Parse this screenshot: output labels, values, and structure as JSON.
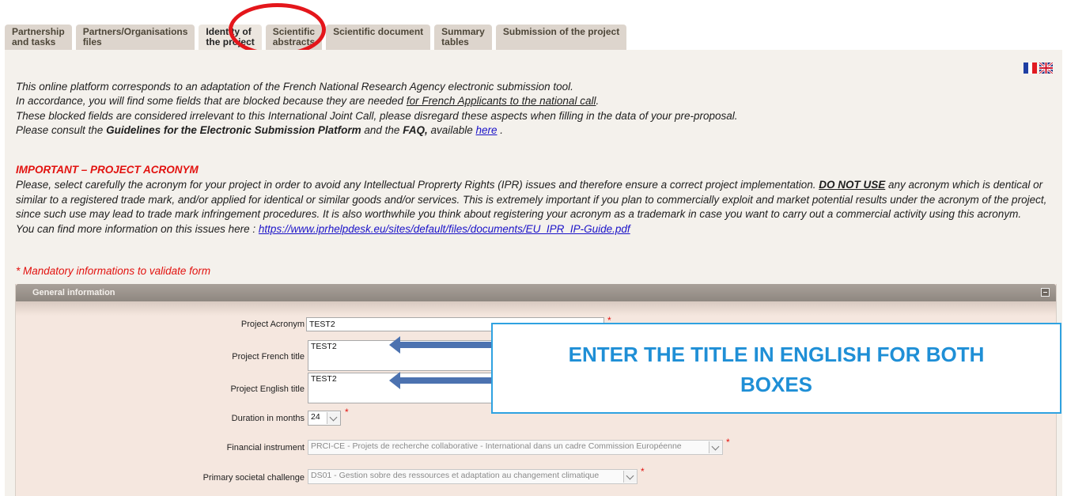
{
  "tabs": [
    {
      "label": "Partnership\nand tasks"
    },
    {
      "label": "Partners/Organisations\nfiles"
    },
    {
      "label": "Identity of\nthe project"
    },
    {
      "label": "Scientific\nabstracts"
    },
    {
      "label": "Scientific document"
    },
    {
      "label": "Summary\ntables"
    },
    {
      "label": "Submission of the project"
    }
  ],
  "active_tab": "Identity of the project",
  "languages": [
    {
      "icon": "french-flag-icon"
    },
    {
      "icon": "uk-flag-icon"
    }
  ],
  "intro": {
    "line1": "This online platform corresponds to an adaptation of the French National Research Agency electronic submission tool.",
    "line2_a": "In accordance, you will find some fields that are blocked  because they are needed ",
    "line2_u": "for French Applicants to the national call",
    "line2_b": ".",
    "line3": "These blocked fields are considered irrelevant to this International Joint Call, please disregard these aspects when filling in the data of your pre-proposal.",
    "line4_a": "Please consult the ",
    "line4_b1": "Guidelines for the Electronic Submission Platform",
    "line4_c": " and the ",
    "line4_b2": "FAQ,",
    "line4_d": " available ",
    "line4_link": "here",
    "line4_e": " ."
  },
  "important": {
    "title": "IMPORTANT – PROJECT ACRONYM",
    "p_a": "Please, select carefully the acronym for your project in order to avoid any Intellectual Proprerty Rights (IPR) issues and therefore ensure a correct project implementation. ",
    "p_bold": "DO NOT USE",
    "p_b": " any acronym which is dentical or similar to a registered trade mark, and/or applied for identical or similar goods and/or services. This is extremely important if you plan to commercially exploit and market potential results under the acronym of the project, since such use may lead to trade mark infringement procedures. It is also worthwhile you think about registering your acronym as a trademark in case you want to carry out a commercial activity using this acronym.",
    "more_prefix": "You can find more information on this issues here : ",
    "more_link": "https://www.iprhelpdesk.eu/sites/default/files/documents/EU_IPR_IP-Guide.pdf"
  },
  "mandatory_note": "* Mandatory informations to validate form",
  "section": {
    "title": "General information",
    "collapse_icon": "minus-box-icon"
  },
  "form": {
    "acronym_label": "Project Acronym",
    "acronym_value": "TEST2",
    "french_title_label": "Project French title",
    "french_title_value": "TEST2",
    "english_title_label": "Project English title",
    "english_title_value": "TEST2",
    "duration_label": "Duration in months",
    "duration_value": "24",
    "financial_label": "Financial instrument",
    "financial_value": "PRCI-CE - Projets de recherche collaborative - International dans un cadre Commission Européenne",
    "challenge_label": "Primary societal challenge",
    "challenge_value": "DS01 - Gestion sobre des ressources et adaptation au changement climatique",
    "required_mark": "*"
  },
  "callout": {
    "line1": "ENTER THE TITLE IN ENGLISH FOR BOTH",
    "line2": "BOXES"
  },
  "colors": {
    "accent_red": "#e2120f",
    "callout_blue": "#1f8fd6",
    "arrow_blue": "#4c72b0"
  }
}
